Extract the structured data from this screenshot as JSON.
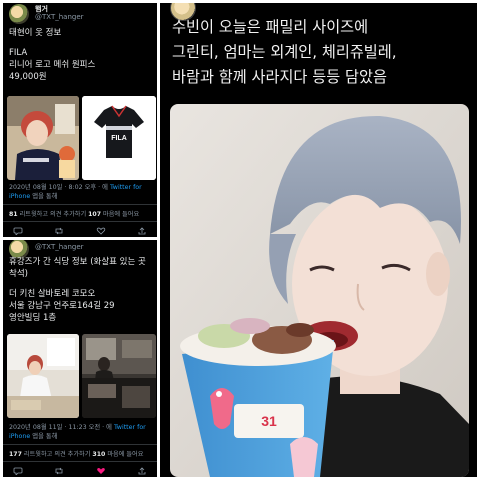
{
  "tweets": [
    {
      "display_name": "햄거",
      "handle": "@TXT_hanger",
      "lines": [
        "태현이 옷 정보",
        "",
        "FILA",
        "리니어 로고 메쉬 원피스",
        "49,000원"
      ],
      "timestamp": "2020년 08월 10일 · 8:02 오후 · 에",
      "client_link": "Twitter for",
      "client_link2": "iPhone",
      "client_suffix": "앱을 통해",
      "retweets": "81",
      "retweets_label": "리트윗하고 의견 추가하기",
      "likes": "107",
      "likes_label": "마음에 들어요",
      "photo_brand": "FILA"
    },
    {
      "display_name": "",
      "handle": "@TXT_hanger",
      "lines": [
        "휴강즈가 간 식당 정보 (화살표 있는 곳",
        "착석)",
        "",
        "더 키친 살바토레 코모오",
        "서울 강남구 언주로164길 29",
        "영안빌딩 1층"
      ],
      "timestamp": "2020년 08월 11일 · 11:23 오전 · 에",
      "client_link": "Twitter for",
      "client_link2": "iPhone",
      "client_suffix": "앱을 통해",
      "retweets": "177",
      "retweets_label": "리트윗하고 의견 추가하기",
      "likes": "310",
      "likes_label": "마음에 들어요"
    },
    {
      "lines": [
        "수빈이 오늘은 패밀리 사이즈에",
        "그린티, 엄마는 외계인, 체리쥬빌레,",
        "바람과 함께 사라지다 등등 담았음"
      ],
      "cup_label": "31"
    }
  ],
  "colors": {
    "background": "#000000",
    "text": "#e7e9ea",
    "muted": "#8b98a5",
    "link": "#1d9bf0",
    "like": "#f91880"
  }
}
